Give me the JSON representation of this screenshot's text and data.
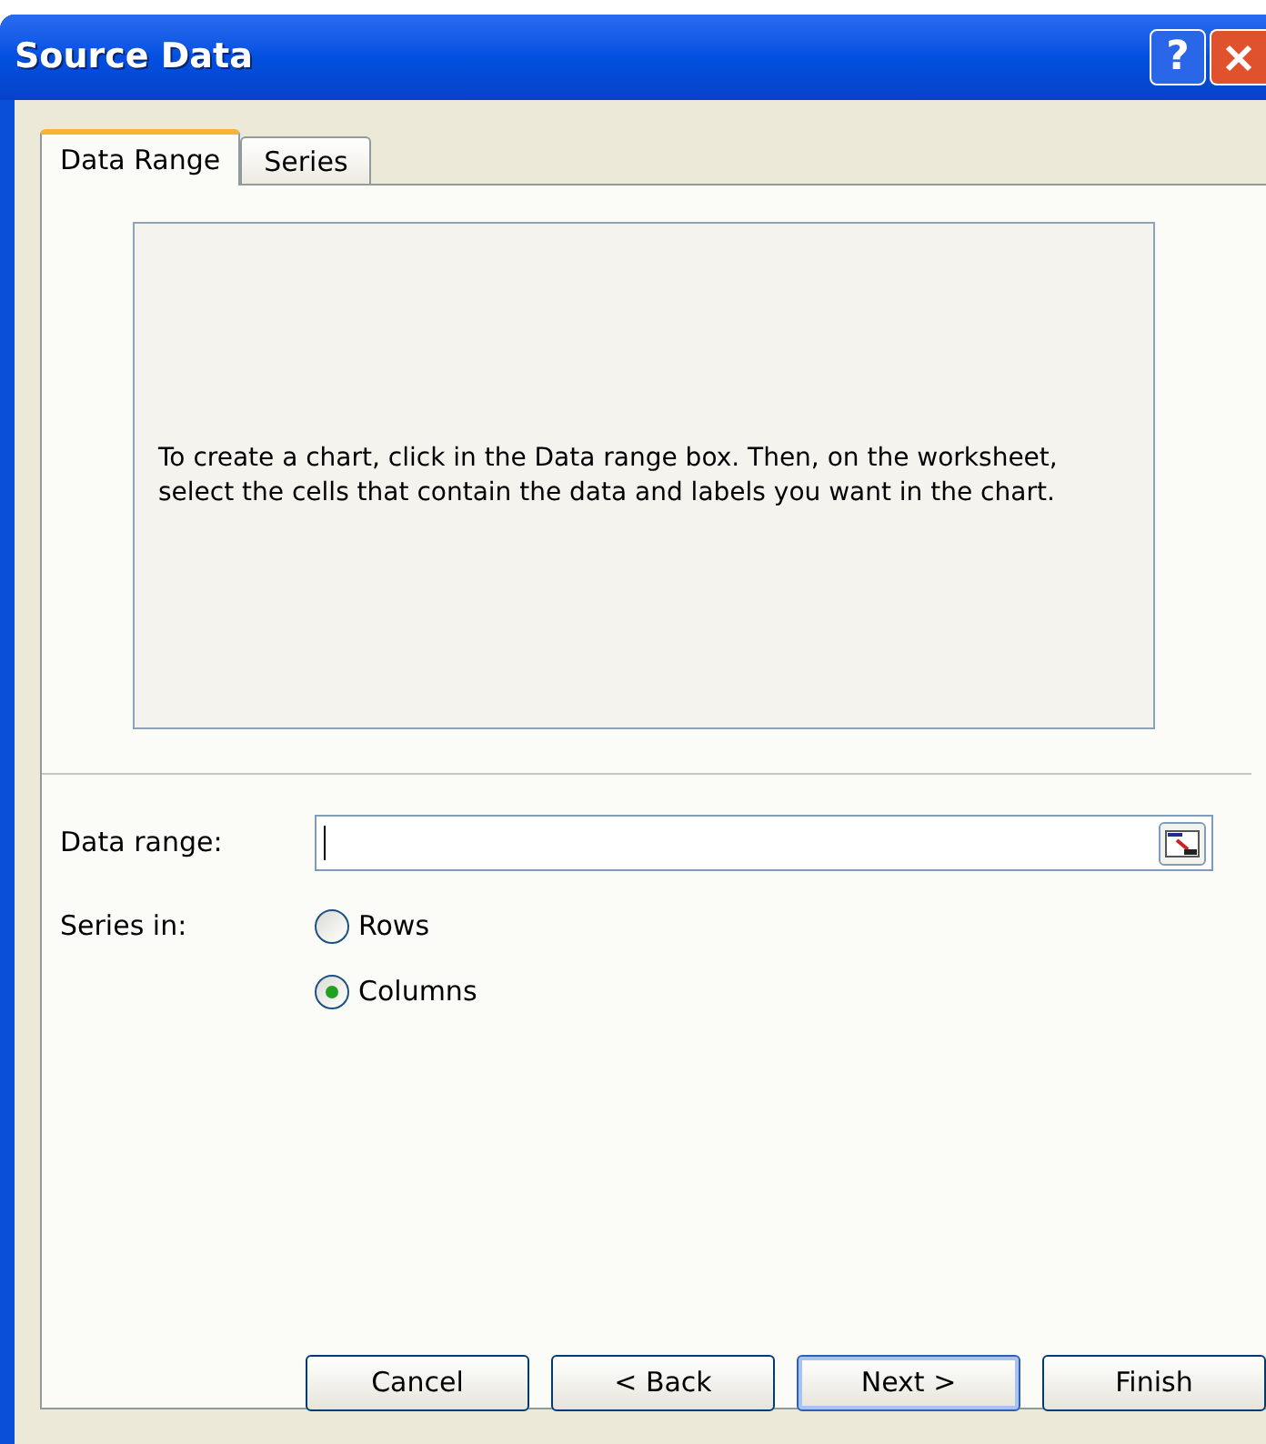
{
  "window": {
    "title": "Source Data",
    "buttons": [
      {
        "kind": "help",
        "label": "?"
      },
      {
        "kind": "close"
      }
    ]
  },
  "tabs": [
    {
      "label": "Data Range",
      "selected": true
    },
    {
      "label": "Series",
      "selected": false
    }
  ],
  "preview": {
    "message": "To create a chart, click in the Data range box. Then, on the worksheet, select the cells that contain the data and labels you want in the chart."
  },
  "data_range": {
    "label": "Data range:"
  },
  "series_in": {
    "label": "Series in:",
    "options": [
      {
        "label": "Rows",
        "selected": false
      },
      {
        "label": "Columns",
        "selected": true
      }
    ]
  },
  "buttons": [
    {
      "label": "Cancel",
      "default": false
    },
    {
      "label": "< Back",
      "default": false
    },
    {
      "label": "Next >",
      "default": true
    },
    {
      "label": "Finish",
      "default": false
    }
  ]
}
